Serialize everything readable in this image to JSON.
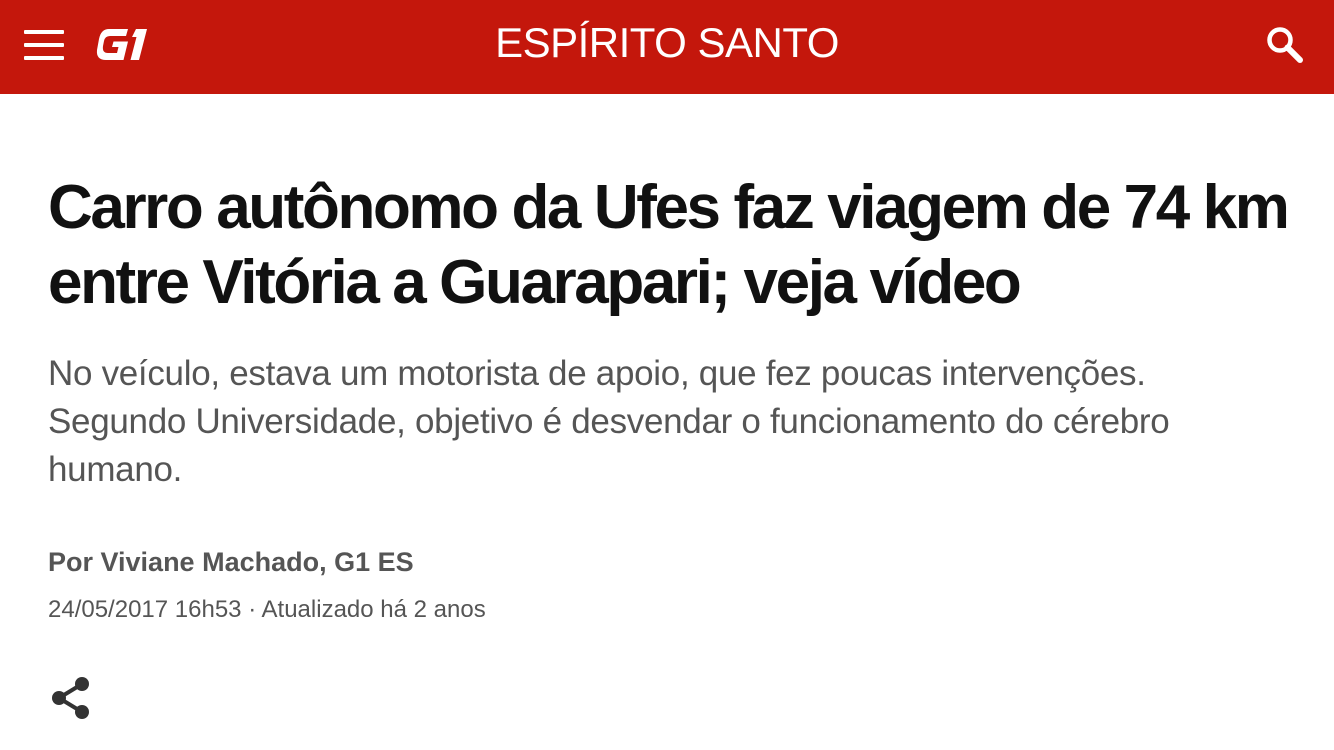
{
  "header": {
    "section_title": "ESPÍRITO SANTO",
    "logo_text": "G1",
    "menu_icon": "hamburger-menu-icon",
    "search_icon": "search-icon",
    "background_color": "#c4170c"
  },
  "article": {
    "headline": "Carro autônomo da Ufes faz viagem de 74 km entre Vitória a Guarapari; veja vídeo",
    "subtitle": "No veículo, estava um motorista de apoio, que fez poucas intervenções. Segundo Universidade, objetivo é desvendar o funcionamento do cérebro humano.",
    "byline": "Por Viviane Machado, G1 ES",
    "dateline": "24/05/2017 16h53 · Atualizado há 2 anos",
    "share_icon": "share-icon"
  }
}
